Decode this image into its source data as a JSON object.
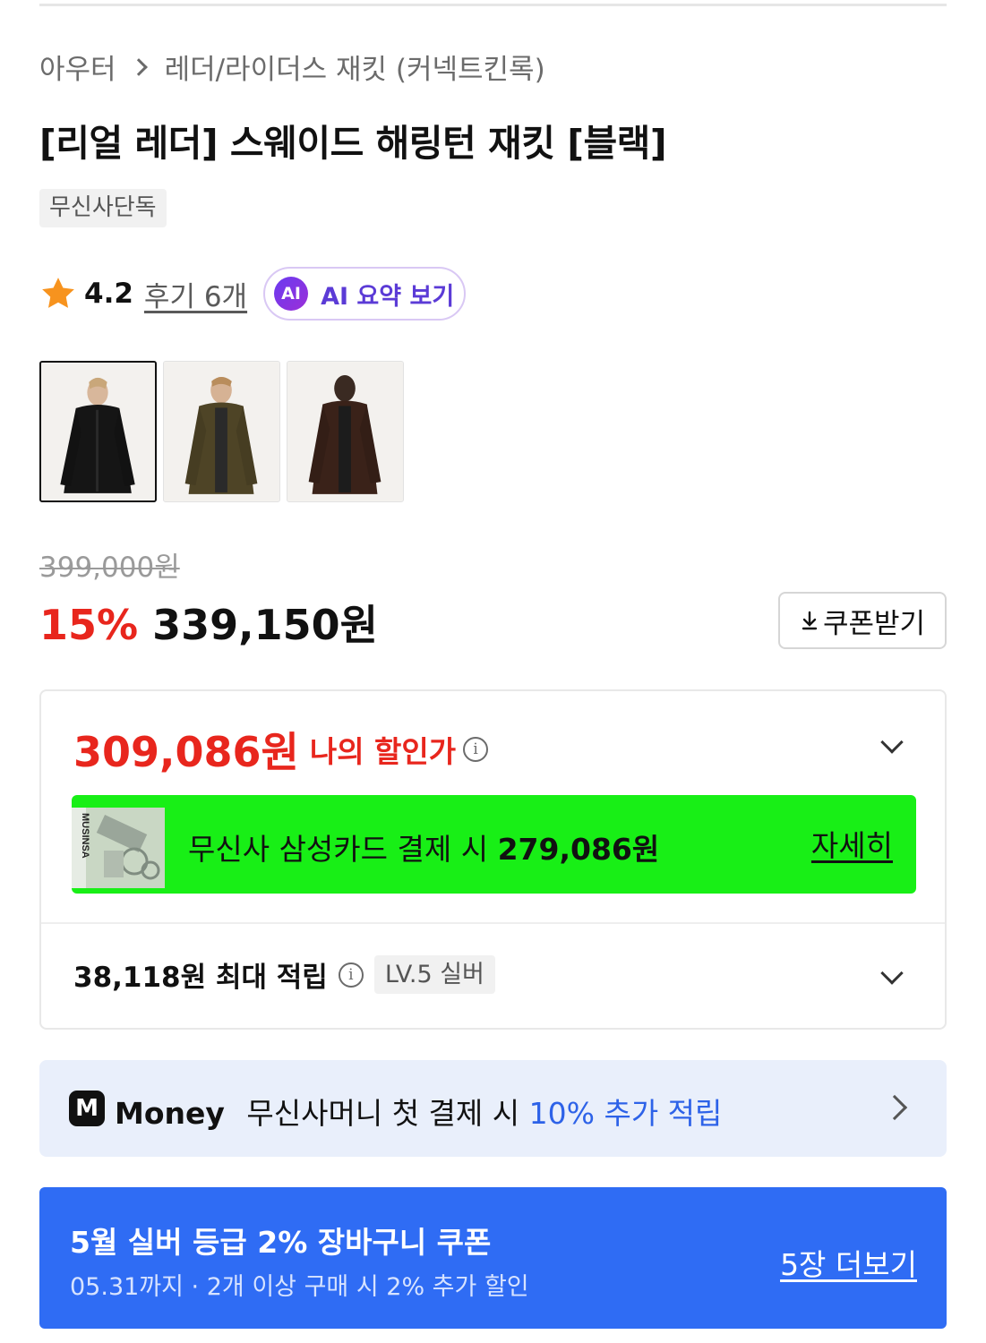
{
  "breadcrumb": {
    "category": "아우터",
    "subcategory": "레더/라이더스 재킷 (커넥트킨록)"
  },
  "product": {
    "title": "[리얼 레더] 스웨이드 해링턴 재킷 [블랙]",
    "exclusive_badge": "무신사단독",
    "rating": "4.2",
    "reviews_label": "후기 6개",
    "ai_badge": "AI",
    "ai_summary_label": "AI 요약 보기",
    "thumbnails": [
      {
        "alt": "black jacket",
        "color": "#151515"
      },
      {
        "alt": "olive jacket",
        "color": "#4e4426"
      },
      {
        "alt": "brown jacket",
        "color": "#3a2219"
      }
    ]
  },
  "pricing": {
    "original_price": "399,000원",
    "discount_rate": "15%",
    "sale_price": "339,150원",
    "coupon_button": "쿠폰받기",
    "my_price": "309,086원",
    "my_price_label": "나의 할인가",
    "samsung_card": {
      "text": "무신사 삼성카드 결제 시",
      "price": "279,086원",
      "detail_link": "자세히",
      "card_brand": "MUSINSA"
    },
    "points": {
      "text": "38,118원 최대 적립",
      "level_badge": "LV.5 실버"
    }
  },
  "money_banner": {
    "logo": "M",
    "brand": "Money",
    "text": "무신사머니 첫 결제 시",
    "highlight": "10% 추가 적립"
  },
  "coupon_banner": {
    "title": "5월 실버 등급 2% 장바구니 쿠폰",
    "subtitle": "05.31까지 · 2개 이상 구매 시 2% 추가 할인",
    "link": "5장 더보기"
  },
  "colors": {
    "accent_red": "#e8261d",
    "samsung_green": "#18ef16",
    "money_blue": "#2d62e8",
    "coupon_blue": "#2f6cf4",
    "ai_purple": "#5b3bd6"
  }
}
